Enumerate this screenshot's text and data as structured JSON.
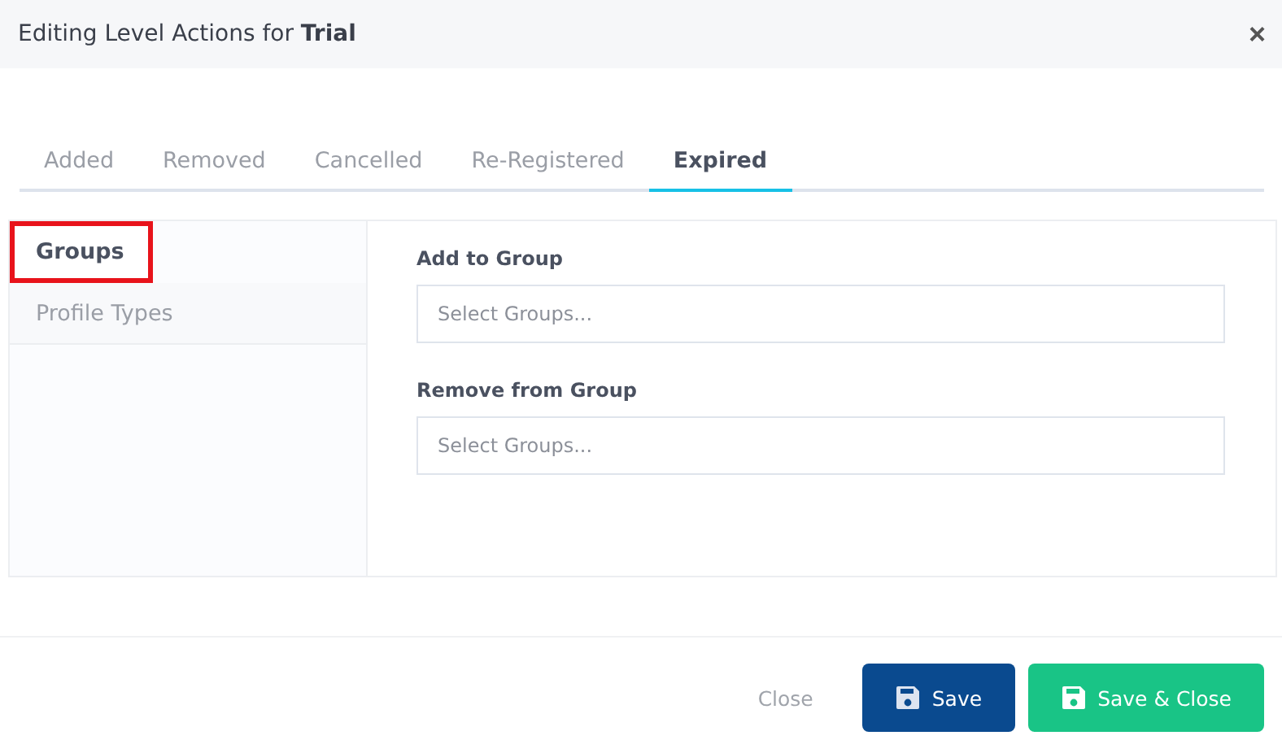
{
  "window": {
    "title": "Editing Level Actions for **Trial**",
    "close": "×"
  },
  "tabs": [
    {
      "label": "Added",
      "selected": false
    },
    {
      "label": "Removed",
      "selected": false
    },
    {
      "label": "Cancelled",
      "selected": false
    },
    {
      "label": "Re-Registered",
      "selected": false
    },
    {
      "label": "Expired",
      "selected": true
    }
  ],
  "sidebar": {
    "items": [
      {
        "label": "Groups",
        "selected": true,
        "highlighted": true
      },
      {
        "label": "Profile Types",
        "selected": false,
        "highlighted": false
      }
    ]
  },
  "fields": [
    {
      "label": "Add to Group",
      "placeholder": "Select Groups..."
    },
    {
      "label": "Remove from Group",
      "placeholder": "Select Groups..."
    }
  ],
  "footer": {
    "buttons": [
      {
        "kind": "link",
        "label": "Close"
      },
      {
        "kind": "primary",
        "label": "Save"
      },
      {
        "kind": "success",
        "label": "Save & Close"
      }
    ]
  }
}
